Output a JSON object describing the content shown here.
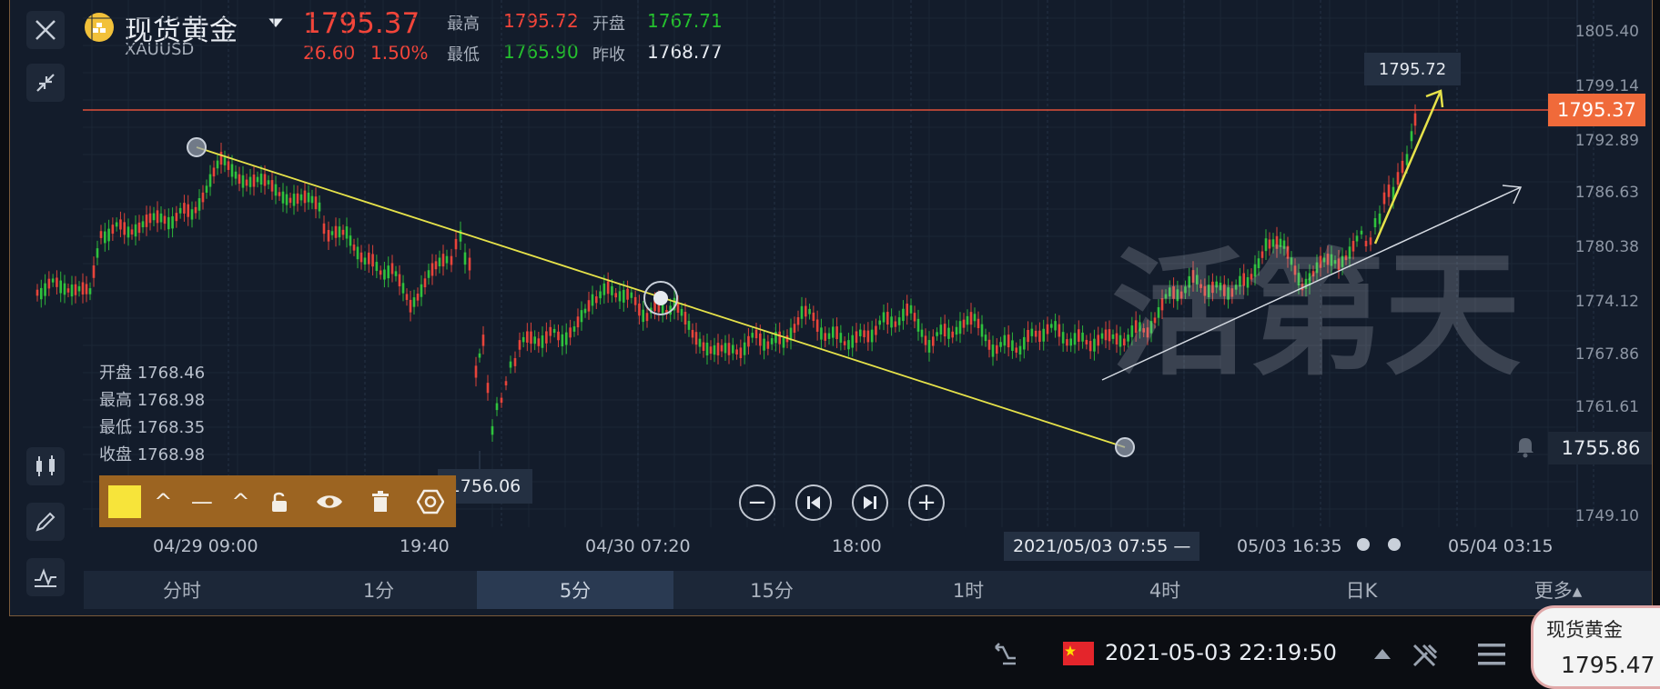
{
  "header": {
    "symbol_name": "现货黄金",
    "symbol_code": "XAUUSD",
    "last_price": "1795.37",
    "change": "26.60",
    "change_pct": "1.50%",
    "high_label": "最高",
    "high_value": "1795.72",
    "open_label": "开盘",
    "open_value": "1767.71",
    "low_label": "最低",
    "low_value": "1765.90",
    "prev_close_label": "昨收",
    "prev_close_value": "1768.77"
  },
  "y_axis": {
    "ticks": [
      "1805.40",
      "1799.14",
      "1792.89",
      "1786.63",
      "1780.38",
      "1774.12",
      "1767.86",
      "1761.61",
      "1749.10"
    ]
  },
  "price_tags": {
    "current": "1795.37",
    "alert": "1755.86",
    "peak_annotation": "1795.72",
    "low_annotation": "1756.06"
  },
  "ohlc_panel": {
    "open_label": "开盘",
    "open_value": "1768.46",
    "high_label": "最高",
    "high_value": "1768.98",
    "low_label": "最低",
    "low_value": "1768.35",
    "close_label": "收盘",
    "close_value": "1768.98"
  },
  "x_axis": {
    "labels": [
      "04/29 09:00",
      "19:40",
      "04/30 07:20",
      "18:00",
      "05/03 16:35",
      "05/04 03:15"
    ],
    "crosshair": "2021/05/03 07:55 —"
  },
  "watermark": "活第天",
  "timeframes": [
    "分时",
    "1分",
    "5分",
    "15分",
    "1时",
    "4时",
    "日K",
    "更多▴"
  ],
  "active_timeframe_index": 2,
  "statusbar": {
    "datetime": "2021-05-03 22:19:50",
    "floating_name": "现货黄金",
    "floating_price": "1795.47"
  },
  "colors": {
    "up": "#f2453a",
    "down": "#25c12e",
    "trendline": "#e6e24a",
    "accent": "#f06a3a"
  }
}
